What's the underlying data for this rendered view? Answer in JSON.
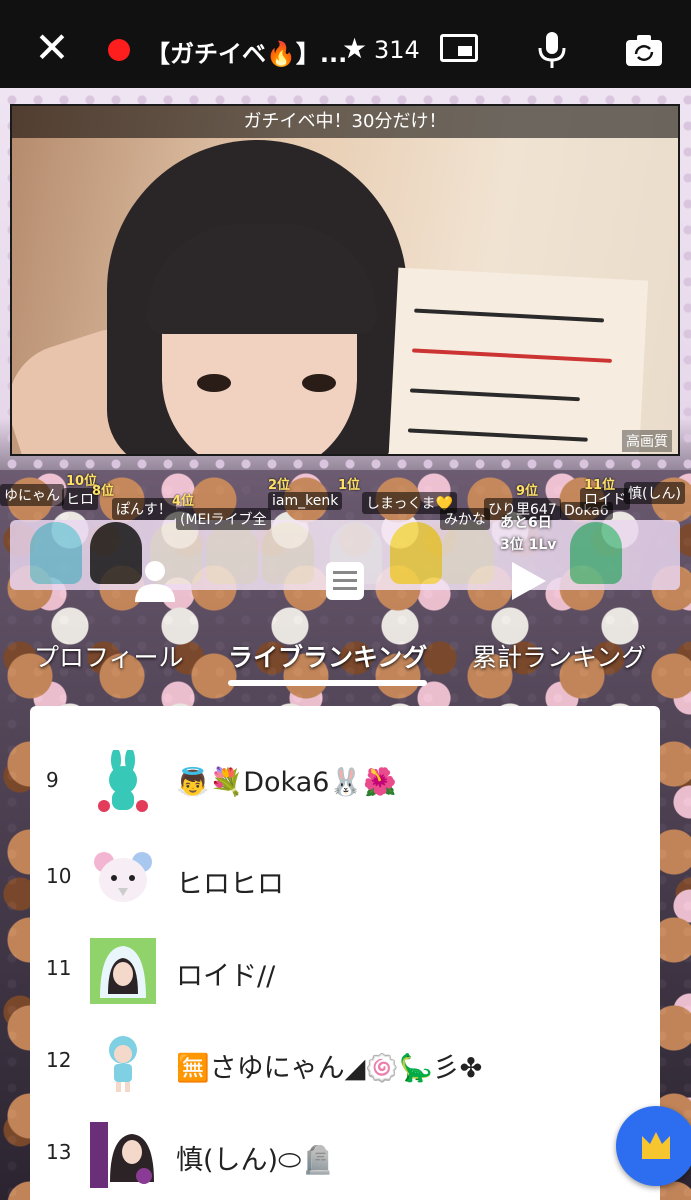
{
  "header": {
    "title": "【ガチイベ🔥】...",
    "star_count": "314"
  },
  "video": {
    "banner": "ガチイベ中！30分だけ！",
    "quality_label": "高画質"
  },
  "stage": {
    "labels": [
      "ゆにゃん",
      "ヒロ",
      "ぽんす！",
      "(MEⅠライブ全",
      "iam_kenk",
      "しまっくま💛",
      "みかな",
      "ひり里647",
      "Doka6",
      "ロイド",
      "慎(しん)"
    ],
    "ranks": [
      "10位",
      "8位",
      "4位",
      "2位",
      "1位",
      "9位",
      "11位"
    ],
    "next_rank": {
      "remaining": "あと6日",
      "level": "3位 1Lv"
    }
  },
  "tabs": [
    {
      "label": "プロフィール",
      "active": false
    },
    {
      "label": "ライブランキング",
      "active": true
    },
    {
      "label": "累計ランキング",
      "active": false
    }
  ],
  "ranking": [
    {
      "rank": "9",
      "name": "👼💐Doka6🐰🌺"
    },
    {
      "rank": "10",
      "name": "ヒロヒロ"
    },
    {
      "rank": "11",
      "name": "ロイド//"
    },
    {
      "rank": "12",
      "name": "🈚さゆにゃん◢🍥🦕彡✤"
    },
    {
      "rank": "13",
      "name": "慎(しん)⬭🪦"
    }
  ],
  "icons": {
    "close": "close-icon",
    "live": "live-indicator-icon",
    "star": "star-icon",
    "pip": "picture-in-picture-icon",
    "mic": "microphone-icon",
    "camera": "camera-switch-icon",
    "profile_tab": "person-icon",
    "live_ranking_tab": "list-icon",
    "total_ranking_tab": "play-icon",
    "fab": "crown-icon"
  },
  "colors": {
    "live": "#ff1e1e",
    "fab": "#2d6ef0",
    "topbar": "#111111"
  }
}
